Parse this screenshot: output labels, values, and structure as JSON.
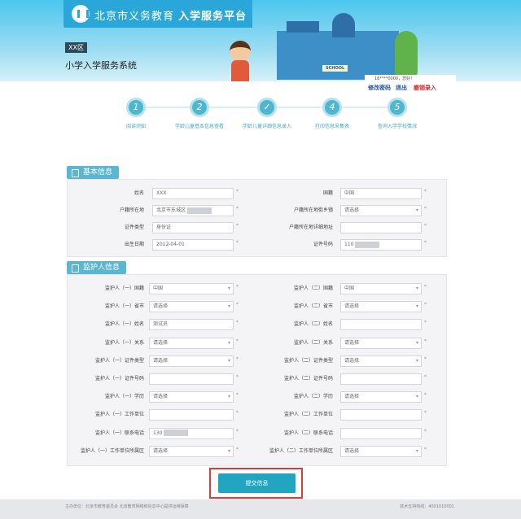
{
  "header": {
    "title_light": "北京市义务教育",
    "title_bold": "入学服务平台",
    "district": "XX区",
    "system_name": "小学入学服务系统",
    "school_sign": "SCHOOL",
    "user_greeting": "18****0000，您好！",
    "links": [
      "修改密码",
      "退出",
      "撤销录入"
    ]
  },
  "steps": [
    {
      "num": "1",
      "label": "阅读须知"
    },
    {
      "num": "2",
      "label": "学龄儿童基本信息查看"
    },
    {
      "num": "✓",
      "label": "学龄儿童详细信息录入"
    },
    {
      "num": "4",
      "label": "打印信息采集表"
    },
    {
      "num": "5",
      "label": "查询入学学校情况"
    }
  ],
  "basic": {
    "title": "基本信息",
    "left": [
      {
        "label": "姓名",
        "value": "XXX",
        "select": false,
        "masked": false
      },
      {
        "label": "户籍所在地",
        "value": "北京市东城区",
        "select": false,
        "masked": true
      },
      {
        "label": "证件类型",
        "value": "身份证",
        "select": false,
        "masked": false
      },
      {
        "label": "出生日期",
        "value": "2012-04-01",
        "select": false,
        "masked": false
      }
    ],
    "right": [
      {
        "label": "国籍",
        "value": "中国",
        "select": false,
        "masked": false
      },
      {
        "label": "户籍所在地街乡镇",
        "value": "请选择",
        "select": true,
        "masked": false
      },
      {
        "label": "户籍所在地详细地址",
        "value": "",
        "select": false,
        "masked": false
      },
      {
        "label": "证件号码",
        "value": "110",
        "select": false,
        "masked": true
      }
    ]
  },
  "guardian": {
    "title": "监护人信息",
    "left": [
      {
        "label": "监护人（一）国籍",
        "value": "中国",
        "select": true
      },
      {
        "label": "监护人（一）省市",
        "value": "请选择",
        "select": true
      },
      {
        "label": "监护人（一）姓名",
        "value": "测试员",
        "select": false
      },
      {
        "label": "监护人（一）关系",
        "value": "请选择",
        "select": true
      },
      {
        "label": "监护人（一）证件类型",
        "value": "请选择",
        "select": true
      },
      {
        "label": "监护人（一）证件号码",
        "value": "",
        "select": false
      },
      {
        "label": "监护人（一）学历",
        "value": "请选择",
        "select": true
      },
      {
        "label": "监护人（一）工作单位",
        "value": "",
        "select": false
      },
      {
        "label": "监护人（一）联系电话",
        "value": "130",
        "select": false,
        "masked": true
      },
      {
        "label": "监护人（一）工作单位所属区",
        "value": "请选择",
        "select": true
      }
    ],
    "right": [
      {
        "label": "监护人（二）国籍",
        "value": "中国",
        "select": true
      },
      {
        "label": "监护人（二）省市",
        "value": "请选择",
        "select": true
      },
      {
        "label": "监护人（二）姓名",
        "value": "",
        "select": false
      },
      {
        "label": "监护人（二）关系",
        "value": "请选择",
        "select": true
      },
      {
        "label": "监护人（二）证件类型",
        "value": "请选择",
        "select": true
      },
      {
        "label": "监护人（二）证件号码",
        "value": "",
        "select": false
      },
      {
        "label": "监护人（二）学历",
        "value": "请选择",
        "select": true
      },
      {
        "label": "监护人（二）工作单位",
        "value": "",
        "select": false
      },
      {
        "label": "监护人（二）联系电话",
        "value": "",
        "select": false
      },
      {
        "label": "监护人（二）工作单位所属区",
        "value": "请选择",
        "select": true
      }
    ]
  },
  "submit_label": "提交信息",
  "footer": {
    "left": "主办单位：北京市教育委员会  北京教育网络和信息中心提供运维保障",
    "right": "技术支持热线：4001010001"
  }
}
